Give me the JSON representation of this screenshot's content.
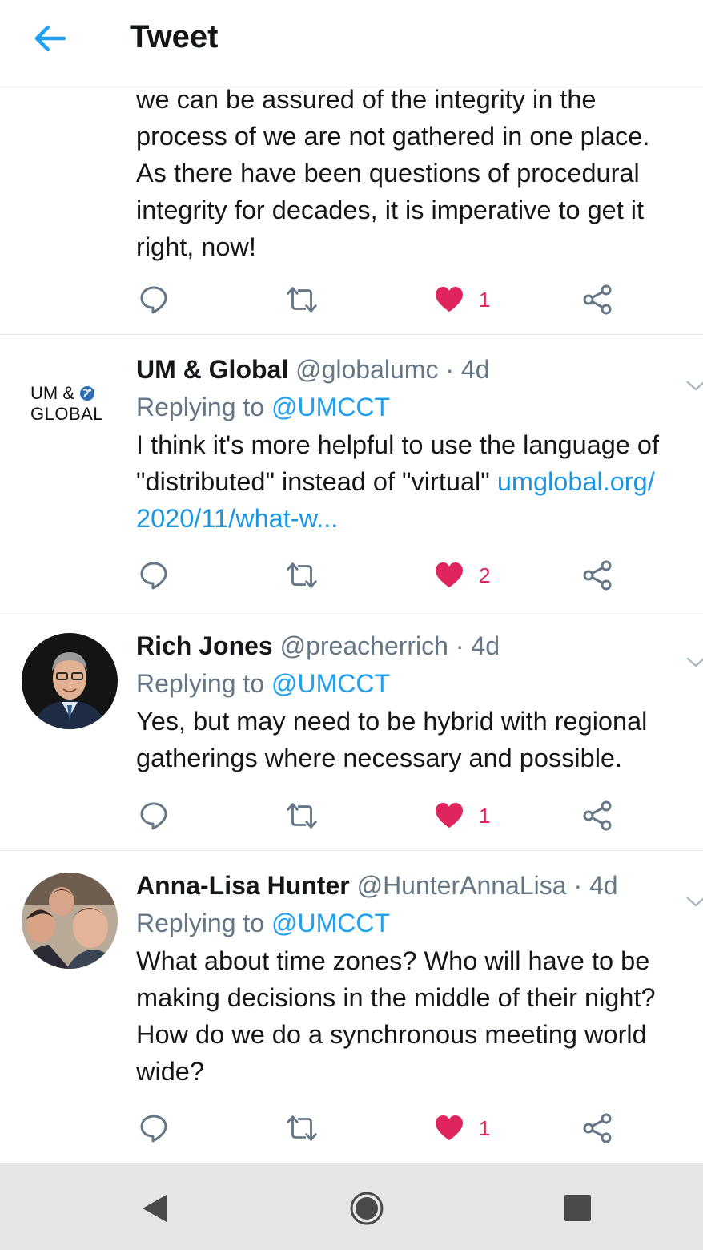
{
  "header": {
    "title": "Tweet",
    "back_icon": "arrow-left-icon"
  },
  "colors": {
    "accent": "#1da1f2",
    "like": "#e0245e",
    "muted": "#657786",
    "text": "#14171a"
  },
  "tweets": [
    {
      "text": "we can be assured of the integrity in the\nprocess of we are not gathered in one place.\nAs there have been questions of procedural\nintegrity for decades, it is imperative to get it\nright, now!",
      "likes": "1"
    },
    {
      "name": "UM & Global",
      "handle": "@globalumc",
      "time": "· 4d",
      "replying_prefix": "Replying to",
      "replying_to": "@UMCCT",
      "avatar_logo_line1": "UM &",
      "avatar_logo_line2": "GLOBAL",
      "text": "I think it's more helpful to use the language of\n\"distributed\" instead of \"virtual\" ",
      "link": "umglobal.org/\n2020/11/what-w...",
      "likes": "2"
    },
    {
      "name": "Rich Jones",
      "handle": "@preacherrich",
      "time": "· 4d",
      "replying_prefix": "Replying to",
      "replying_to": "@UMCCT",
      "text": "Yes, but may need to be hybrid with regional\ngatherings where necessary and possible.",
      "likes": "1"
    },
    {
      "name": "Anna-Lisa Hunter",
      "handle": "@HunterAnnaLisa",
      "time": "· 4d",
      "replying_prefix": "Replying to",
      "replying_to": "@UMCCT",
      "text": "What about time zones? Who will have to be\nmaking decisions in the middle of their night?\nHow do we do a synchronous meeting world\nwide?",
      "likes": "1"
    }
  ],
  "navbar": {
    "icons": [
      "nav-back-icon",
      "nav-home-icon",
      "nav-recents-icon"
    ]
  }
}
